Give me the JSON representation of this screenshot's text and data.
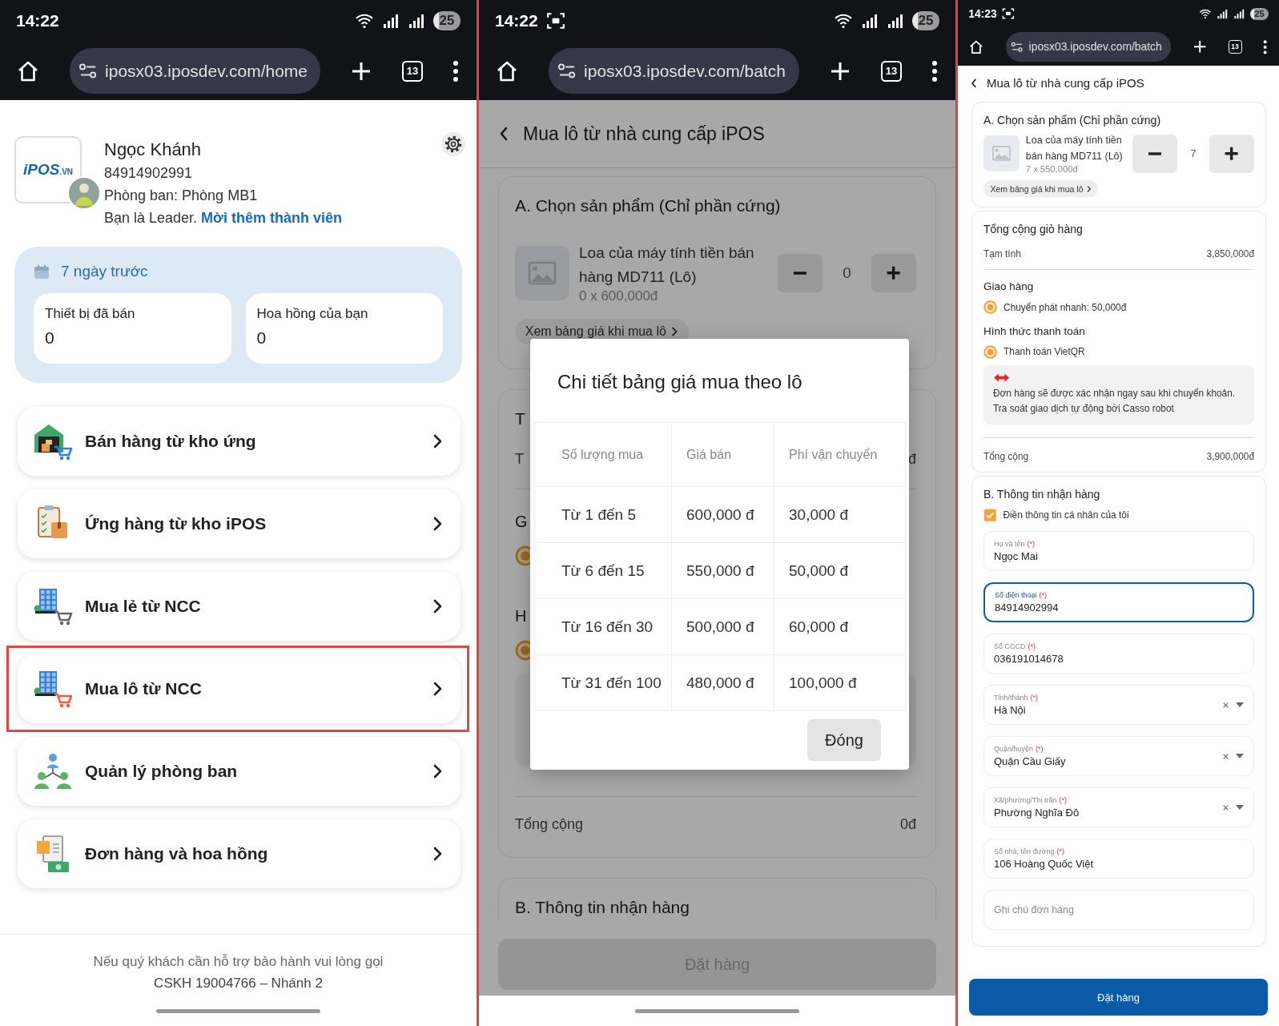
{
  "phones": [
    {
      "kind": "home",
      "status_bar": {
        "time": "14:22",
        "battery": "25"
      },
      "browser": {
        "url": "iposx03.iposdev.com/home",
        "tab_count": "13"
      },
      "profile": {
        "logo": "iPOS",
        "logo_suffix": ".VN",
        "name": "Ngọc Khánh",
        "phone": "84914902991",
        "department": "Phòng ban: Phòng MB1",
        "role": "Bạn là Leader.",
        "invite_link": "Mời thêm thành viên"
      },
      "stats": {
        "period": "7 ngày trước",
        "tiles": [
          {
            "label": "Thiết bị đã bán",
            "value": "0"
          },
          {
            "label": "Hoa hồng của bạn",
            "value": "0"
          }
        ]
      },
      "menu": [
        {
          "label": "Bán hàng từ kho ứng",
          "highlighted": false
        },
        {
          "label": "Ứng hàng từ kho iPOS",
          "highlighted": false
        },
        {
          "label": "Mua lẻ từ NCC",
          "highlighted": false
        },
        {
          "label": "Mua lô từ NCC",
          "highlighted": true
        },
        {
          "label": "Quản lý phòng ban",
          "highlighted": false
        },
        {
          "label": "Đơn hàng và hoa hồng",
          "highlighted": false
        }
      ],
      "footer": {
        "lines": [
          "Nếu quý khách cần hỗ trợ bảo hành vui lòng gọi",
          "CSKH 19004766 – Nhánh 2"
        ]
      },
      "home_indicator": true
    },
    {
      "kind": "batch_order",
      "status_bar": {
        "time": "14:22",
        "screenshot_indicator": true,
        "battery": "25"
      },
      "browser": {
        "url": "iposx03.iposdev.com/batch",
        "tab_count": "13"
      },
      "title": "Mua lô từ nhà cung cấp iPOS",
      "product_section": {
        "title": "A. Chọn sản phẩm (Chỉ phần cứng)",
        "product": {
          "name": "Loa của máy tính tiền bán hàng MD711 (Lô)",
          "price_line": "0 x 600,000đ",
          "quantity": "0"
        },
        "price_link": "Xem bảng giá khi mua lô"
      },
      "cart_section": {
        "title": "T",
        "subtotal": {
          "label": "T",
          "value": "đ"
        },
        "shipping": {
          "title": "G",
          "option": {
            "selected": true
          }
        },
        "payment": {
          "title": "H",
          "option": {
            "selected": true
          }
        },
        "total": {
          "label": "Tổng cộng",
          "value": "0đ"
        }
      },
      "receiver_section": {
        "title": "B. Thông tin nhận hàng"
      },
      "order_button": {
        "label": "Đặt hàng",
        "disabled": true
      },
      "modal": {
        "title": "Chi tiết bảng giá mua theo lô",
        "columns": [
          "Số lượng mua",
          "Giá bán",
          "Phí vận chuyển"
        ],
        "rows": [
          [
            "Từ 1 đến 5",
            "600,000 đ",
            "30,000 đ"
          ],
          [
            "Từ 6 đến 15",
            "550,000 đ",
            "50,000 đ"
          ],
          [
            "Từ 16 đến 30",
            "500,000 đ",
            "60,000 đ"
          ],
          [
            "Từ 31 đến 100",
            "480,000 đ",
            "100,000 đ"
          ]
        ],
        "close_button": "Đóng"
      },
      "home_indicator": true
    },
    {
      "kind": "batch_order",
      "status_bar": {
        "time": "14:23",
        "screenshot_indicator": true,
        "battery": "25"
      },
      "browser": {
        "url": "iposx03.iposdev.com/batch",
        "tab_count": "13"
      },
      "title": "Mua lô từ nhà cung cấp iPOS",
      "product_section": {
        "title": "A. Chọn sản phẩm (Chỉ phần cứng)",
        "product": {
          "name": "Loa của máy tính tiền bán hàng MD711 (Lô)",
          "price_line": "7 x 550,000đ",
          "quantity": "7"
        },
        "price_link": "Xem bảng giá khi mua lô"
      },
      "cart_section": {
        "title": "Tổng cộng giỏ hàng",
        "subtotal": {
          "label": "Tạm tính",
          "value": "3,850,000đ"
        },
        "shipping": {
          "title": "Giao hàng",
          "option": {
            "label": "Chuyển phát nhanh: 50,000đ",
            "selected": true
          }
        },
        "payment": {
          "title": "Hình thức thanh toán",
          "option": {
            "label": "Thanh toán VietQR",
            "selected": true
          },
          "note": "Đơn hàng sẽ được xác nhận ngay sau khi chuyển khoản. Tra soát giao dịch tự động bởi Casso robot"
        },
        "total": {
          "label": "Tổng cộng",
          "value": "3,900,000đ"
        }
      },
      "receiver_section": {
        "title": "B. Thông tin nhận hàng",
        "self_fill": {
          "label": "Điền thông tin cá nhân của tôi",
          "checked": true
        },
        "fields": [
          {
            "kind": "text",
            "label": "Họ và tên",
            "required_mark": "(*)",
            "value": "Ngọc Mai",
            "focused": false
          },
          {
            "kind": "text",
            "label": "Số điện thoại",
            "required_mark": "(*)",
            "value": "84914902994",
            "focused": true
          },
          {
            "kind": "text",
            "label": "Số CCCD",
            "required_mark": "(*)",
            "value": "036191014678",
            "focused": false
          },
          {
            "kind": "select",
            "label": "Tỉnh/thành",
            "required_mark": "(*)",
            "value": "Hà Nội",
            "focused": false
          },
          {
            "kind": "select",
            "label": "Quận/huyện",
            "required_mark": "(*)",
            "value": "Quận Cầu Giấy",
            "focused": false
          },
          {
            "kind": "select",
            "label": "Xã/phường/Thị trấn",
            "required_mark": "(*)",
            "value": "Phường Nghĩa Đô",
            "focused": false
          },
          {
            "kind": "text",
            "label": "Số nhà, tên đường",
            "required_mark": "(*)",
            "value": "106 Hoàng Quốc Việt",
            "focused": false
          },
          {
            "kind": "textarea",
            "placeholder": "Ghi chú đơn hàng",
            "focused": false
          }
        ]
      },
      "order_button": {
        "label": "Đặt hàng",
        "disabled": false
      }
    }
  ]
}
